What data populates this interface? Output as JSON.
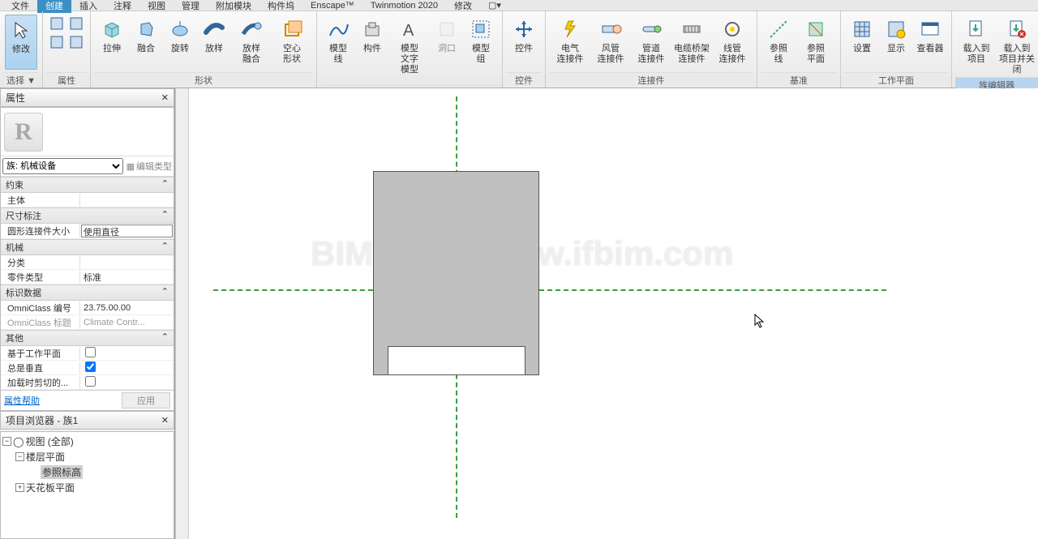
{
  "menu": {
    "items": [
      "文件",
      "创建",
      "插入",
      "注释",
      "视图",
      "管理",
      "附加模块",
      "构件坞",
      "Enscape™",
      "Twinmotion 2020",
      "修改"
    ],
    "active_index": 1,
    "extra_icon": "camera-dropdown-icon"
  },
  "ribbon": {
    "groups": [
      {
        "label": "选择",
        "items": [
          {
            "name": "modify",
            "label": "修改",
            "icon": "cursor",
            "highlight": true
          }
        ],
        "mini": [
          {
            "n": "link",
            "active": false
          },
          {
            "n": "row1",
            "active": true
          },
          {
            "n": "row2",
            "active": false
          }
        ]
      },
      {
        "label": "属性",
        "items": [],
        "mini_blocks": [
          [
            {
              "n": "prop-a"
            },
            {
              "n": "prop-b"
            }
          ],
          [
            {
              "n": "prop-c"
            },
            {
              "n": "prop-d"
            }
          ]
        ]
      },
      {
        "label": "形状",
        "items": [
          {
            "name": "extrude",
            "label": "拉伸",
            "icon": "box-blue"
          },
          {
            "name": "blend",
            "label": "融合",
            "icon": "blend"
          },
          {
            "name": "rotate",
            "label": "旋转",
            "icon": "rotate"
          },
          {
            "name": "sweep",
            "label": "放样",
            "icon": "sweep"
          },
          {
            "name": "sweep-blend",
            "label": "放样\n融合",
            "icon": "sweep-blend"
          },
          {
            "name": "void",
            "label": "空心\n形状",
            "icon": "void"
          }
        ]
      },
      {
        "label": "",
        "items": [
          {
            "name": "model-line",
            "label": "模型\n线",
            "icon": "mline"
          },
          {
            "name": "component",
            "label": "构件",
            "icon": "component"
          },
          {
            "name": "model-text",
            "label": "模型\n文字\n模型",
            "icon": "mtext"
          },
          {
            "name": "opening",
            "label": "洞口",
            "icon": "opening",
            "dim": true
          },
          {
            "name": "model-group",
            "label": "模型\n组",
            "icon": "mgroup"
          }
        ]
      },
      {
        "label": "控件",
        "items": [
          {
            "name": "control",
            "label": "控件",
            "icon": "control"
          }
        ]
      },
      {
        "label": "连接件",
        "items": [
          {
            "name": "elec-conn",
            "label": "电气\n连接件",
            "icon": "elec"
          },
          {
            "name": "duct-conn",
            "label": "风管\n连接件",
            "icon": "duct"
          },
          {
            "name": "pipe-conn",
            "label": "管道\n连接件",
            "icon": "pipe"
          },
          {
            "name": "cable-conn",
            "label": "电缆桥架\n连接件",
            "icon": "cable"
          },
          {
            "name": "wire-conn",
            "label": "线管\n连接件",
            "icon": "wire"
          }
        ]
      },
      {
        "label": "基准",
        "items": [
          {
            "name": "ref-line",
            "label": "参照\n线",
            "icon": "refline"
          },
          {
            "name": "ref-plane",
            "label": "参照\n平面",
            "icon": "refplane"
          }
        ]
      },
      {
        "label": "工作平面",
        "items": [
          {
            "name": "set",
            "label": "设置",
            "icon": "set"
          },
          {
            "name": "show",
            "label": "显示",
            "icon": "show"
          },
          {
            "name": "viewer",
            "label": "查看器",
            "icon": "viewer"
          }
        ]
      },
      {
        "label": "族编辑器",
        "highlight": true,
        "items": [
          {
            "name": "load-proj",
            "label": "载入到\n项目",
            "icon": "load"
          },
          {
            "name": "load-close",
            "label": "载入到\n项目并关闭",
            "icon": "loadclose"
          }
        ]
      }
    ]
  },
  "properties_panel": {
    "title": "属性",
    "type_selector": "族: 机械设备",
    "edit_type": "编辑类型",
    "sections": [
      {
        "name": "约束",
        "rows": [
          {
            "k": "主体",
            "v": ""
          }
        ]
      },
      {
        "name": "尺寸标注",
        "rows": [
          {
            "k": "圆形连接件大小",
            "v": "使用直径",
            "boxed": true
          }
        ]
      },
      {
        "name": "机械",
        "rows": [
          {
            "k": "分类",
            "v": ""
          },
          {
            "k": "零件类型",
            "v": "标准"
          }
        ]
      },
      {
        "name": "标识数据",
        "rows": [
          {
            "k": "OmniClass 编号",
            "v": "23.75.00.00"
          },
          {
            "k": "OmniClass 标题",
            "v": "Climate Contr...",
            "dim": true
          }
        ]
      },
      {
        "name": "其他",
        "rows": [
          {
            "k": "基于工作平面",
            "v": "",
            "cb": false
          },
          {
            "k": "总是垂直",
            "v": "",
            "cb": true
          },
          {
            "k": "加载时剪切的...",
            "v": "",
            "cb": false
          }
        ]
      }
    ],
    "help": "属性帮助",
    "apply": "应用"
  },
  "browser": {
    "title": "项目浏览器 - 族1",
    "tree": [
      {
        "tw": "-",
        "icon": "o",
        "label": "视图 (全部)",
        "lvl": 0
      },
      {
        "tw": "-",
        "label": "楼层平面",
        "lvl": 1
      },
      {
        "tw": "",
        "label": "参照标高",
        "lvl": 2,
        "selected": true
      },
      {
        "tw": "+",
        "label": "天花板平面",
        "lvl": 1
      }
    ]
  },
  "canvas": {
    "watermark": "BIM教程网|www.ifbim.com"
  }
}
